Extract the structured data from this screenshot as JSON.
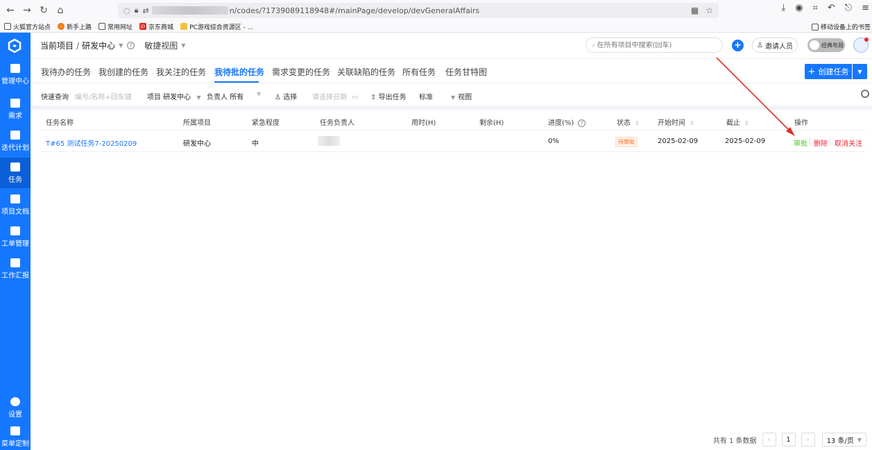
{
  "browser": {
    "url_suffix": "n/codes/?1739089118948#/mainPage/develop/devGeneralAffairs",
    "bookmarks": [
      "火狐官方站点",
      "新手上路",
      "常用网址",
      "京东商城",
      "PC游戏综合资源区 - ..."
    ],
    "bookmarks_right": "移动设备上的书签"
  },
  "sidebar": {
    "items": [
      {
        "label": "管理中心"
      },
      {
        "label": "需求"
      },
      {
        "label": "迭代计划"
      },
      {
        "label": "任务"
      },
      {
        "label": "项目文档"
      },
      {
        "label": "工单管理"
      },
      {
        "label": "工作汇报"
      }
    ],
    "bottom": [
      {
        "label": "设置"
      },
      {
        "label": "菜单定制"
      }
    ]
  },
  "header": {
    "current_project": "当前项目",
    "project_name": "研发中心",
    "agile_view": "敏捷视图",
    "search_placeholder": "在所有项目中搜索(回车)",
    "invite": "邀请人员",
    "layout_toggle": "经典布局"
  },
  "tabs": [
    {
      "label": "我待办的任务"
    },
    {
      "label": "我创建的任务"
    },
    {
      "label": "我关注的任务"
    },
    {
      "label": "我待批的任务"
    },
    {
      "label": "需求变更的任务"
    },
    {
      "label": "关联缺陷的任务"
    },
    {
      "label": "所有任务"
    },
    {
      "label": "任务甘特图"
    }
  ],
  "create_task": "创建任务",
  "filters": {
    "quick_query": "快速查询",
    "quick_query_placeholder": "编号/名称+回车键",
    "project_label": "项目",
    "project_value": "研发中心",
    "owner_label": "负责人",
    "owner_value": "所有",
    "select": "选择",
    "date_placeholder": "请选择日期",
    "export": "导出任务",
    "standard": "标准",
    "view": "视图"
  },
  "table": {
    "columns": [
      "任务名称",
      "所属项目",
      "紧急程度",
      "任务负责人",
      "用时(H)",
      "剩余(H)",
      "进度(%)",
      "状态",
      "开始时间",
      "截止",
      "操作"
    ],
    "rows": [
      {
        "name": "T#65 测试任务7-20250209",
        "project": "研发中心",
        "urgency": "中",
        "owner": "",
        "used": "",
        "remaining": "",
        "progress": "0%",
        "status": "待审批",
        "start": "2025-02-09",
        "end": "2025-02-09",
        "ops": [
          "审批",
          "删除",
          "取消关注"
        ]
      }
    ]
  },
  "pager": {
    "total": "共有 1 条数据",
    "current_page": "1",
    "page_size": "13 条/页"
  }
}
